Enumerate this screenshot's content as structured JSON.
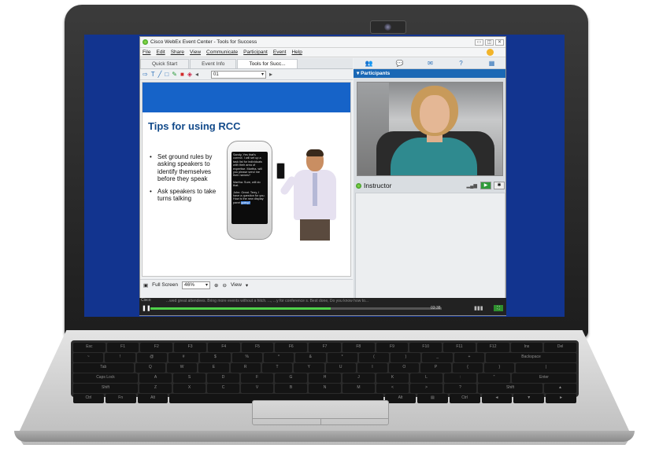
{
  "window": {
    "title": "Cisco WebEx Event Center - Tools for Success",
    "controls": [
      "▭",
      "◫",
      "✕"
    ]
  },
  "menu": [
    "File",
    "Edit",
    "Share",
    "View",
    "Communicate",
    "Participant",
    "Event",
    "Help"
  ],
  "tabs": [
    {
      "label": "Quick Start",
      "active": false
    },
    {
      "label": "Event Info",
      "active": false
    },
    {
      "label": "Tools for Succ...",
      "active": true
    }
  ],
  "toolbar": {
    "page_value": "01"
  },
  "slide": {
    "title": "Tips for using RCC",
    "bullets": [
      "Set ground rules by asking speakers to identify themselves before they speak",
      "Ask speakers to take turns talking"
    ],
    "phone_chat": [
      "Sandy, Yes that's correct. I will set up a task list for individuals with their area of expertise. Martha, will you please send me their names?",
      "Martha: Sure, will do that.",
      "John: Great. Terry, I have a question for you. How is the new display panel "
    ],
    "phone_highlight": "going?"
  },
  "bottom_bar": {
    "full_screen_label": "Full Screen",
    "zoom_value": "46%",
    "view_label": "View"
  },
  "panel": {
    "header": "Participants",
    "presenter_name": "Instructor"
  },
  "media_bar": {
    "caption_label": "Cisco",
    "ticker": "...wed great attendees. Bring more events without a hitch. ..., ...y for conference s. Best done, Do you know how to...",
    "time": "03:38",
    "progress_fraction": 0.62
  },
  "keyboard": {
    "rows": [
      [
        "Esc",
        "F1",
        "F2",
        "F3",
        "F4",
        "F5",
        "F6",
        "F7",
        "F8",
        "F9",
        "F10",
        "F11",
        "F12",
        "Ins",
        "Del"
      ],
      [
        "~",
        "!",
        "@",
        "#",
        "$",
        "%",
        "^",
        "&",
        "*",
        "(",
        ")",
        "_",
        "+",
        "Backspace"
      ],
      [
        "Tab",
        "Q",
        "W",
        "E",
        "R",
        "T",
        "Y",
        "U",
        "I",
        "O",
        "P",
        "{",
        "}",
        "|"
      ],
      [
        "Caps Lock",
        "A",
        "S",
        "D",
        "F",
        "G",
        "H",
        "J",
        "K",
        "L",
        ":",
        "\"",
        "Enter"
      ],
      [
        "Shift",
        "Z",
        "X",
        "C",
        "V",
        "B",
        "N",
        "M",
        "<",
        ">",
        "?",
        "Shift",
        "▲"
      ],
      [
        "Ctrl",
        "Fn",
        "Alt",
        "",
        "Alt",
        "▤",
        "Ctrl",
        "◄",
        "▼",
        "►"
      ]
    ]
  },
  "colors": {
    "screen_bg": "#12348f",
    "slide_banner": "#1663c8",
    "slide_title": "#124a8a",
    "panel_header": "#1a68b5",
    "progress": "#4fd14a"
  },
  "icons": {
    "toolbar": [
      "arrow-icon",
      "text-icon",
      "line-icon",
      "rectangle-icon",
      "pen-icon",
      "color-icon",
      "eraser-icon"
    ],
    "panel_tabs": [
      "participants-icon",
      "chat-icon",
      "notes-icon",
      "qa-icon",
      "poll-icon"
    ]
  }
}
